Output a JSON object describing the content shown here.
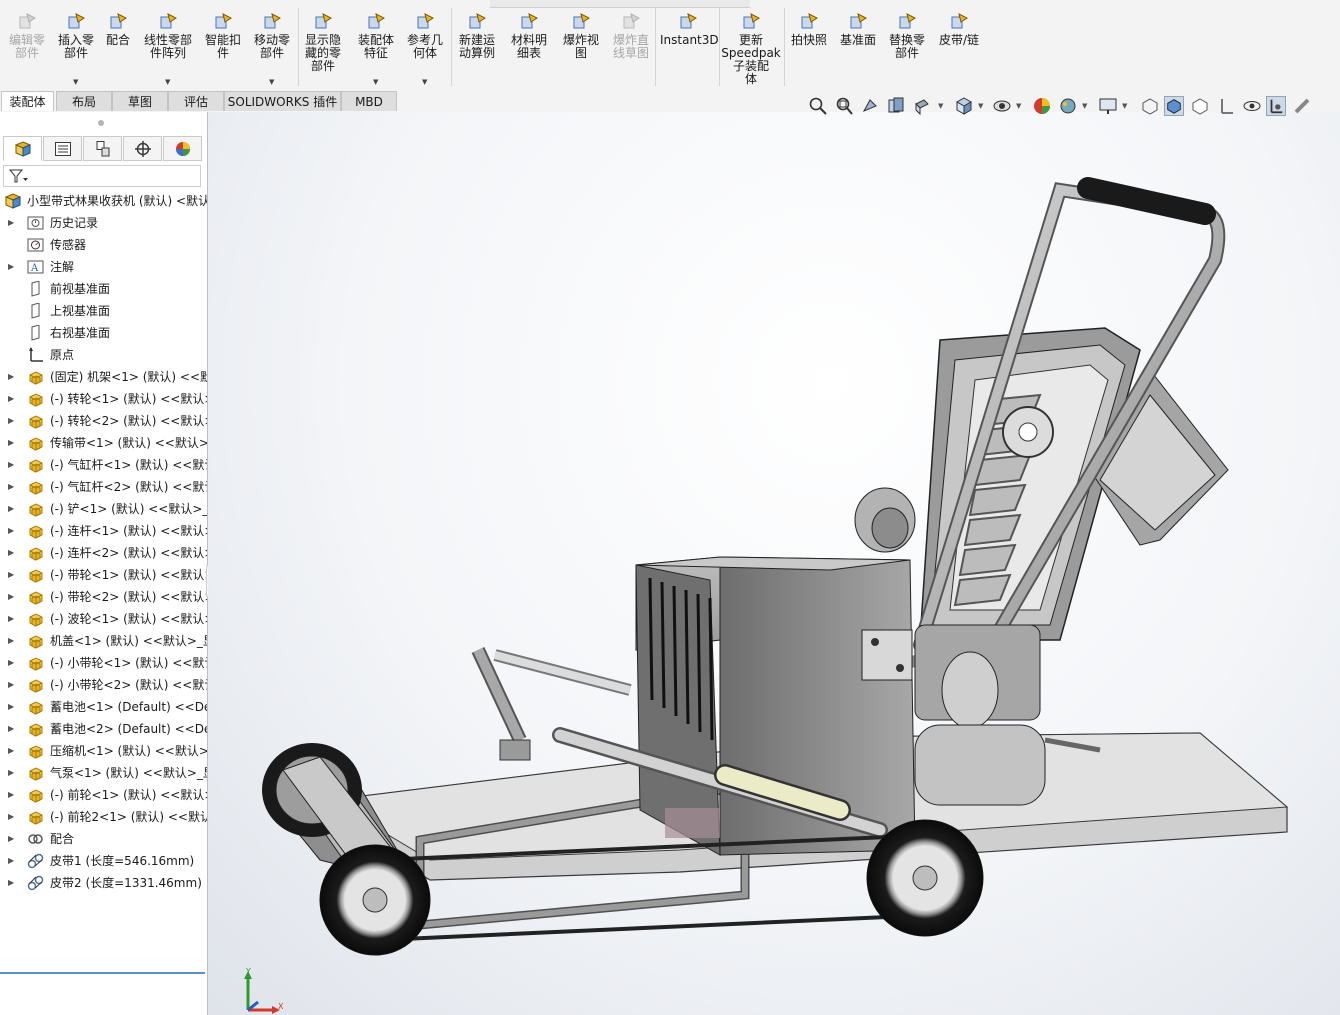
{
  "ribbon": {
    "buttons": [
      {
        "label": "编辑零\n部件",
        "icon": "edit-component-icon",
        "disabled": true
      },
      {
        "label": "插入零\n部件",
        "icon": "insert-component-icon",
        "dropdown": true
      },
      {
        "label": "配合",
        "icon": "mate-icon"
      },
      {
        "label": "线性零部\n件阵列",
        "icon": "linear-pattern-icon",
        "dropdown": true
      },
      {
        "label": "智能扣\n件",
        "icon": "smart-fastener-icon"
      },
      {
        "label": "移动零\n部件",
        "icon": "move-component-icon",
        "dropdown": true
      },
      {
        "label": "显示隐\n藏的零\n部件",
        "icon": "show-hidden-icon"
      },
      {
        "label": "装配体\n特征",
        "icon": "assembly-feature-icon",
        "dropdown": true
      },
      {
        "label": "参考几\n何体",
        "icon": "reference-geometry-icon",
        "dropdown": true
      },
      {
        "label": "新建运\n动算例",
        "icon": "motion-study-icon"
      },
      {
        "label": "材料明\n细表",
        "icon": "bom-icon"
      },
      {
        "label": "爆炸视\n图",
        "icon": "exploded-view-icon"
      },
      {
        "label": "爆炸直\n线草图",
        "icon": "explode-line-icon",
        "disabled": true
      },
      {
        "label": "Instant3D",
        "icon": "instant3d-icon"
      },
      {
        "label": "更新\nSpeedpak\n子装配\n体",
        "icon": "speedpak-icon"
      },
      {
        "label": "拍快照",
        "icon": "camera-icon"
      },
      {
        "label": "基准面",
        "icon": "plane-icon"
      },
      {
        "label": "替换零\n部件",
        "icon": "replace-component-icon"
      },
      {
        "label": "皮带/链",
        "icon": "belt-chain-icon"
      }
    ]
  },
  "tabs": [
    {
      "label": "装配体",
      "active": true
    },
    {
      "label": "布局"
    },
    {
      "label": "草图"
    },
    {
      "label": "评估"
    },
    {
      "label": "SOLIDWORKS 插件"
    },
    {
      "label": "MBD"
    }
  ],
  "feature_tree": {
    "root": "小型带式林果收获机 (默认) <默认",
    "nodes": [
      {
        "label": "历史记录",
        "icon": "history-icon",
        "expandable": true
      },
      {
        "label": "传感器",
        "icon": "sensor-icon"
      },
      {
        "label": "注解",
        "icon": "annotation-icon",
        "expandable": true
      },
      {
        "label": "前视基准面",
        "icon": "plane-icon"
      },
      {
        "label": "上视基准面",
        "icon": "plane-icon"
      },
      {
        "label": "右视基准面",
        "icon": "plane-icon"
      },
      {
        "label": "原点",
        "icon": "origin-icon"
      },
      {
        "label": "(固定) 机架<1> (默认) <<默",
        "icon": "part-icon",
        "expandable": true
      },
      {
        "label": "(-) 转轮<1> (默认) <<默认>",
        "icon": "part-icon",
        "expandable": true
      },
      {
        "label": "(-) 转轮<2> (默认) <<默认>",
        "icon": "part-icon",
        "expandable": true
      },
      {
        "label": "传输带<1> (默认) <<默认>_",
        "icon": "part-icon",
        "expandable": true
      },
      {
        "label": "(-) 气缸杆<1> (默认) <<默认",
        "icon": "part-icon",
        "expandable": true
      },
      {
        "label": "(-) 气缸杆<2> (默认) <<默认",
        "icon": "part-icon",
        "expandable": true
      },
      {
        "label": "(-) 铲<1> (默认) <<默认>_显",
        "icon": "part-icon",
        "expandable": true
      },
      {
        "label": "(-) 连杆<1> (默认) <<默认>",
        "icon": "part-icon",
        "expandable": true
      },
      {
        "label": "(-) 连杆<2> (默认) <<默认>",
        "icon": "part-icon",
        "expandable": true
      },
      {
        "label": "(-) 带轮<1> (默认) <<默认>",
        "icon": "part-icon",
        "expandable": true
      },
      {
        "label": "(-) 带轮<2> (默认) <<默认>",
        "icon": "part-icon",
        "expandable": true
      },
      {
        "label": "(-) 波轮<1> (默认) <<默认>",
        "icon": "part-icon",
        "expandable": true
      },
      {
        "label": "机盖<1> (默认) <<默认>_显",
        "icon": "part-icon",
        "expandable": true
      },
      {
        "label": "(-) 小带轮<1> (默认) <<默认",
        "icon": "part-icon",
        "expandable": true
      },
      {
        "label": "(-) 小带轮<2> (默认) <<默认",
        "icon": "part-icon",
        "expandable": true
      },
      {
        "label": "蓄电池<1> (Default) <<Def",
        "icon": "part-icon",
        "expandable": true
      },
      {
        "label": "蓄电池<2> (Default) <<Def",
        "icon": "part-icon",
        "expandable": true
      },
      {
        "label": "压缩机<1> (默认) <<默认>_",
        "icon": "part-icon",
        "expandable": true
      },
      {
        "label": "气泵<1> (默认) <<默认>_显",
        "icon": "part-icon",
        "expandable": true
      },
      {
        "label": "(-) 前轮<1> (默认) <<默认>",
        "icon": "part-icon",
        "expandable": true
      },
      {
        "label": "(-) 前轮2<1> (默认) <<默认",
        "icon": "part-icon",
        "expandable": true
      },
      {
        "label": "配合",
        "icon": "mates-icon",
        "expandable": true
      },
      {
        "label": "皮带1 (长度=546.16mm)",
        "icon": "belt-icon",
        "expandable": true
      },
      {
        "label": "皮带2 (长度=1331.46mm)",
        "icon": "belt-icon",
        "expandable": true
      }
    ]
  },
  "triad": {
    "x": "X",
    "y": "Y"
  },
  "colors": {
    "accent": "#1f77c9",
    "part_icon": "#e8b22a",
    "model_grey": "#8c8c8c"
  }
}
